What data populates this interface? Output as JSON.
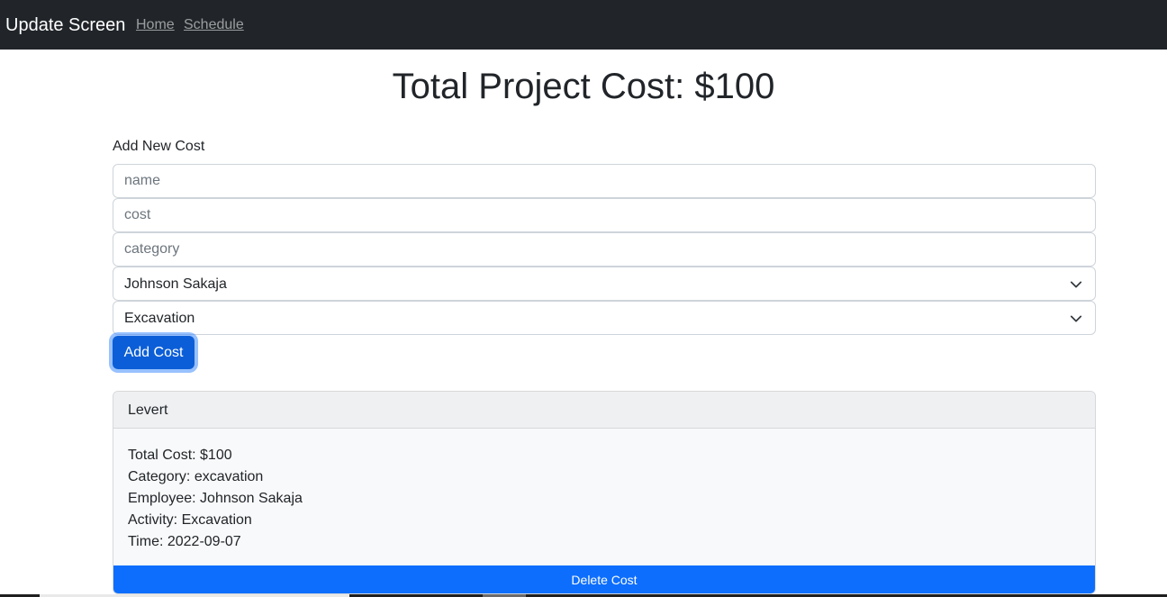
{
  "navbar": {
    "brand": "Update Screen",
    "links": [
      "Home",
      "Schedule"
    ],
    "background": "#212529"
  },
  "page": {
    "title": "Total Project Cost: $100"
  },
  "form": {
    "label": "Add New Cost",
    "name_placeholder": "name",
    "cost_placeholder": "cost",
    "category_placeholder": "category",
    "employee_selected": "Johnson Sakaja",
    "activity_selected": "Excavation",
    "add_button": "Add Cost",
    "accent": "#0b5ed7"
  },
  "cost_card": {
    "header": "Levert",
    "lines": [
      "Total Cost: $100",
      "Category: excavation",
      "Employee: Johnson Sakaja",
      "Activity: Excavation",
      "Time: 2022-09-07"
    ],
    "delete_button": "Delete Cost",
    "delete_color": "#0d6efd"
  }
}
